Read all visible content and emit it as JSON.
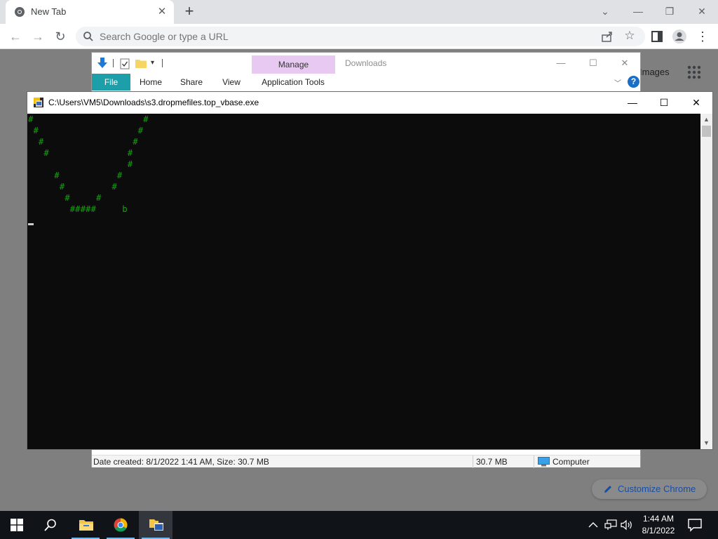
{
  "chrome": {
    "tab_title": "New Tab",
    "tab_close": "✕",
    "new_tab": "+",
    "window_controls": {
      "menu": "⌄",
      "minimize": "—",
      "restore": "❐",
      "close": "✕"
    },
    "omnibox_placeholder": "Search Google or type a URL",
    "images_link": "Images",
    "customize_label": "Customize Chrome"
  },
  "explorer": {
    "manage_tab": "Manage",
    "title": "Downloads",
    "tabs": [
      "File",
      "Home",
      "Share",
      "View",
      "Application Tools"
    ],
    "window_controls": {
      "minimize": "—",
      "maximize": "☐",
      "close": "✕"
    },
    "help": "?",
    "status": {
      "info": "Date created: 8/1/2022 1:41 AM, Size: 30.7 MB",
      "size": "30.7 MB",
      "location": "Computer"
    }
  },
  "console": {
    "title": "C:\\Users\\VM5\\Downloads\\s3.dropmefiles.top_vbase.exe",
    "window_controls": {
      "minimize": "—",
      "maximize": "☐",
      "close": "✕"
    },
    "output_lines": [
      "#                     #",
      " #                   #",
      "  #                 #",
      "   #               #",
      "                   #",
      "     #           #",
      "      #         #",
      "       #     #",
      "        #####     b"
    ],
    "text_color": "#13a10e"
  },
  "taskbar": {
    "time": "1:44 AM",
    "date": "8/1/2022",
    "items": [
      "start",
      "search",
      "file-explorer",
      "chrome",
      "console-app"
    ]
  }
}
